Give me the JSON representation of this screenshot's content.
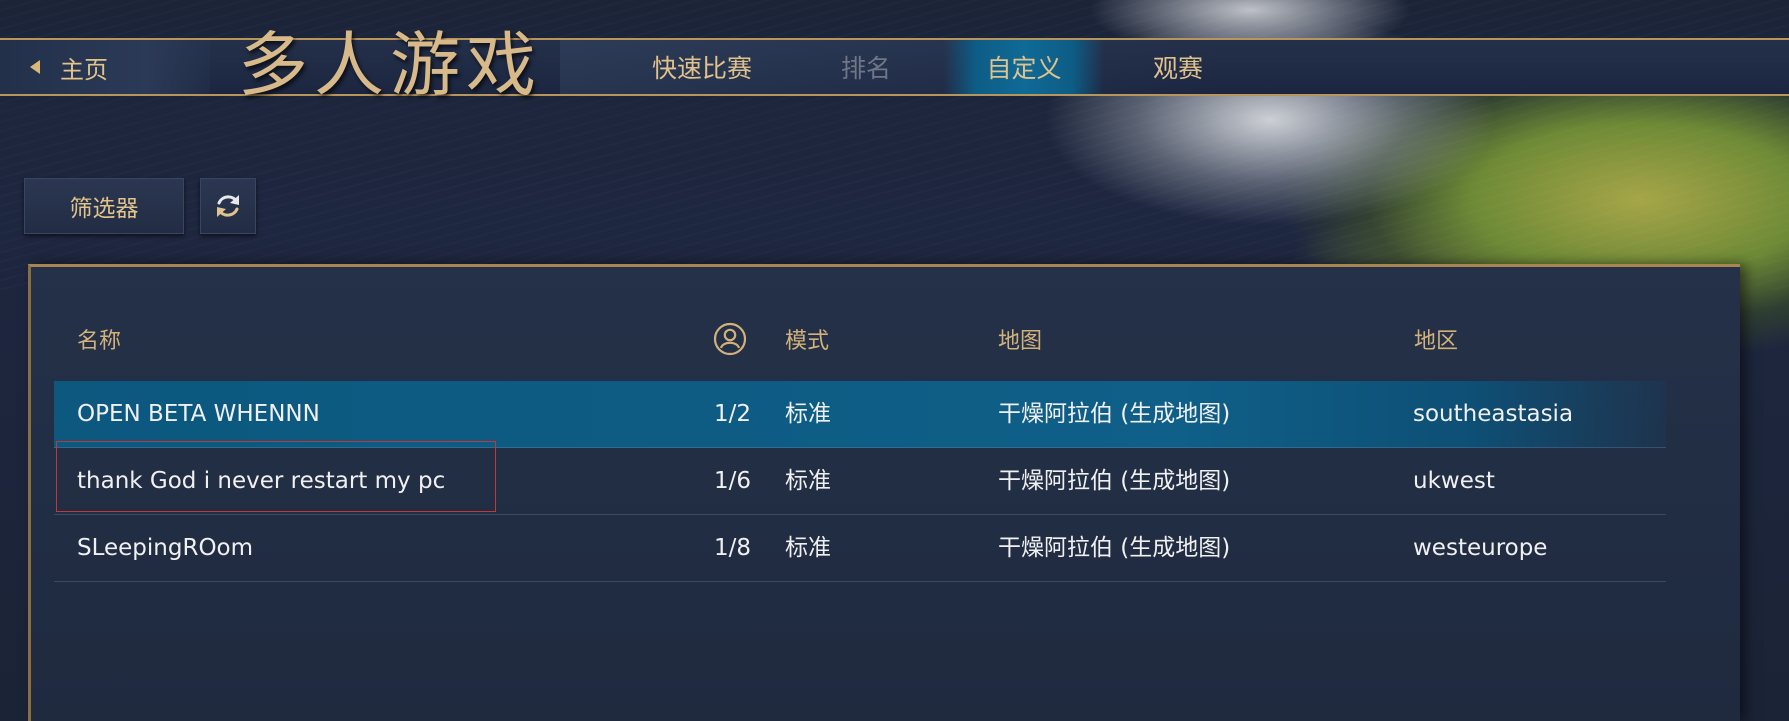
{
  "nav": {
    "home_label": "主页",
    "page_title": "多人游戏",
    "tabs": [
      {
        "label": "快速比赛",
        "state": "normal"
      },
      {
        "label": "排名",
        "state": "disabled"
      },
      {
        "label": "自定义",
        "state": "active"
      },
      {
        "label": "观赛",
        "state": "normal"
      }
    ]
  },
  "toolbar": {
    "filter_label": "筛选器",
    "refresh_icon": "refresh-icon"
  },
  "table": {
    "columns": {
      "name": "名称",
      "players_icon": "players-icon",
      "mode": "模式",
      "map": "地图",
      "region": "地区"
    },
    "rows": [
      {
        "name": "OPEN BETA WHENNN",
        "players": "1/2",
        "mode": "标准",
        "map": "干燥阿拉伯 (生成地图)",
        "region": "southeastasia",
        "selected": true
      },
      {
        "name": "thank God i never restart my pc",
        "players": "1/6",
        "mode": "标准",
        "map": "干燥阿拉伯 (生成地图)",
        "region": "ukwest",
        "selected": false
      },
      {
        "name": "SLeepingROom",
        "players": "1/8",
        "mode": "标准",
        "map": "干燥阿拉伯 (生成地图)",
        "region": "westeurope",
        "selected": false
      }
    ]
  },
  "colors": {
    "gold_text": "#e0c28c",
    "selected_row": "#0f5f88",
    "highlight_box": "#c0393a"
  }
}
